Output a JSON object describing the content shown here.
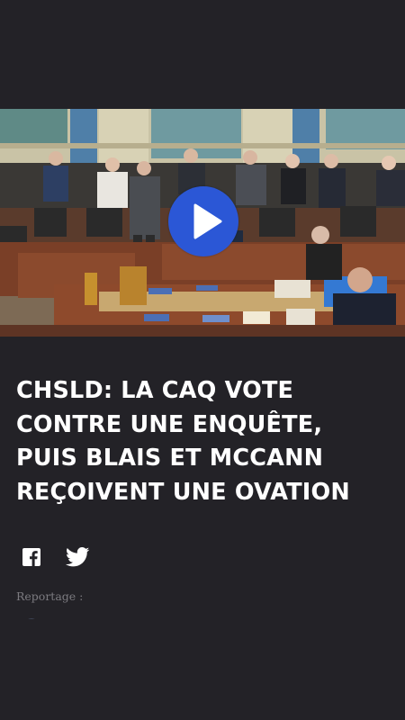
{
  "video": {
    "play_icon": "play-icon",
    "accent_color": "#2b57d6"
  },
  "article": {
    "headline_lines": [
      "CHSLD: LA CAQ VOTE",
      "CONTRE UNE ENQUÊTE,",
      "PUIS BLAIS ET MCCANN",
      "REÇOIVENT UNE OVATION"
    ],
    "byline_label": "Reportage :"
  },
  "share": {
    "icons": [
      "facebook-icon",
      "twitter-icon"
    ]
  }
}
